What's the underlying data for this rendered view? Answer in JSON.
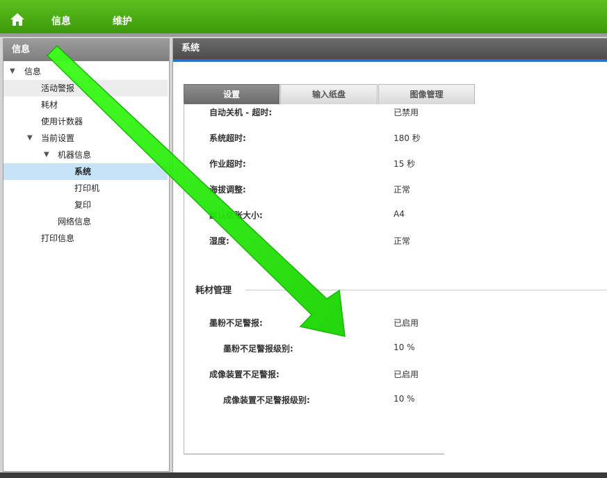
{
  "top_nav": {
    "home_icon": "home-icon",
    "items": [
      "信息",
      "维护"
    ]
  },
  "left_panel": {
    "header": "信息",
    "tree": [
      {
        "label": "信息",
        "expanded": true
      },
      {
        "label": "活动警报"
      },
      {
        "label": "耗材"
      },
      {
        "label": "使用计数器"
      },
      {
        "label": "当前设置",
        "expanded": true
      },
      {
        "label": "机器信息",
        "expanded": true
      },
      {
        "label": "系统",
        "selected": true
      },
      {
        "label": "打印机"
      },
      {
        "label": "复印"
      },
      {
        "label": "网络信息"
      },
      {
        "label": "打印信息"
      }
    ]
  },
  "right_panel": {
    "header": "系统",
    "tabs": [
      "设置",
      "输入纸盘",
      "图像管理"
    ],
    "active_tab": "设置",
    "settings": [
      {
        "label": "自动关机 - 超时:",
        "value": "已禁用"
      },
      {
        "label": "系统超时:",
        "value": "180 秒"
      },
      {
        "label": "作业超时:",
        "value": "15 秒"
      },
      {
        "label": "海拔调整:",
        "value": "正常"
      },
      {
        "label": "默认纸张大小:",
        "value": "A4"
      },
      {
        "label": "湿度:",
        "value": "正常"
      }
    ],
    "supplies_section": {
      "title": "耗材管理",
      "items": [
        {
          "label": "墨粉不足警报:",
          "value": "已启用"
        },
        {
          "label": "墨粉不足警报级别:",
          "value": "10 %"
        },
        {
          "label": "成像装置不足警报:",
          "value": "已启用"
        },
        {
          "label": "成像装置不足警报级别:",
          "value": "10 %"
        }
      ]
    }
  },
  "colors": {
    "top_bar": "#4cae16",
    "annotation_arrow": "#22e000",
    "selected_row": "#c7e3f7",
    "accent_line": "#2a6fd0"
  }
}
